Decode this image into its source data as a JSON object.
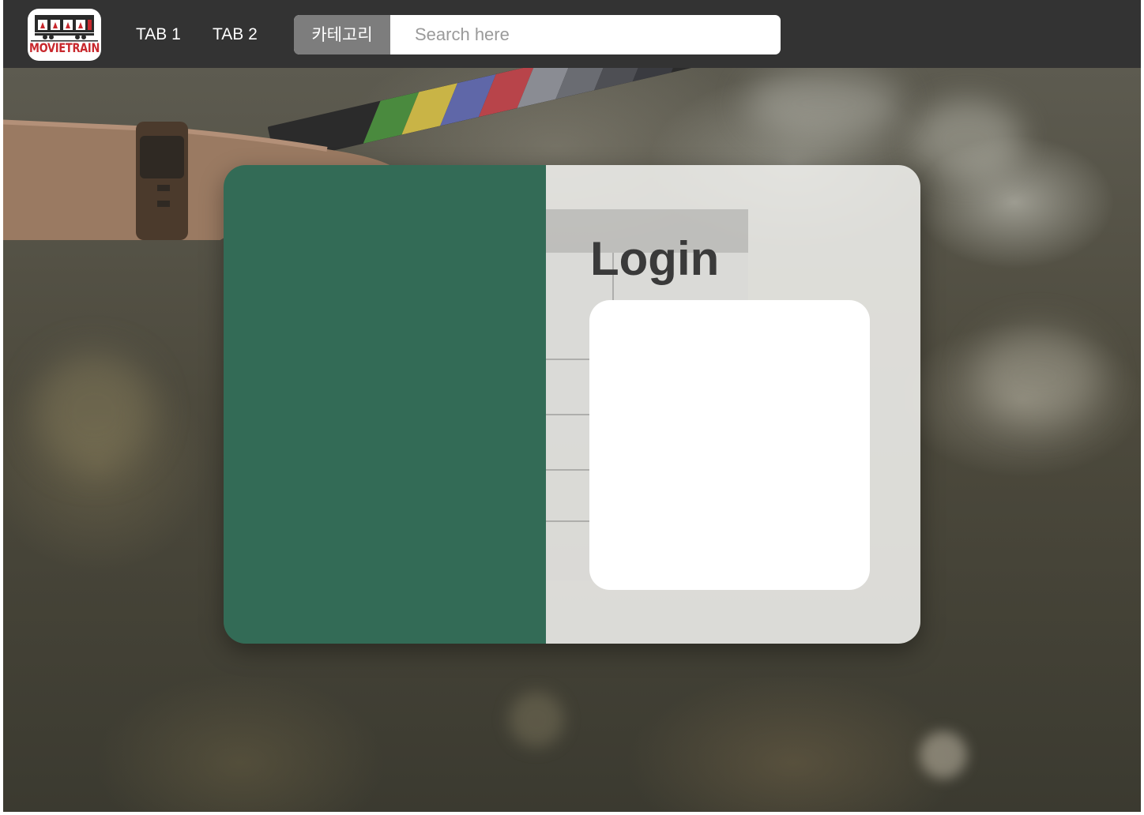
{
  "navbar": {
    "logo_text": "MOVIETRAIN",
    "tabs": [
      {
        "label": "TAB 1"
      },
      {
        "label": "TAB 2"
      }
    ],
    "search": {
      "category_label": "카테고리",
      "placeholder": "Search here"
    }
  },
  "login": {
    "title": "Login"
  },
  "colors": {
    "navbar_bg": "#333333",
    "card_left": "#336b56",
    "category_btn": "#7d7d7d",
    "logo_red": "#c8282d"
  },
  "icons": {
    "logo": "movietrain-logo-icon",
    "hero": "film-clapperboard-photo"
  }
}
